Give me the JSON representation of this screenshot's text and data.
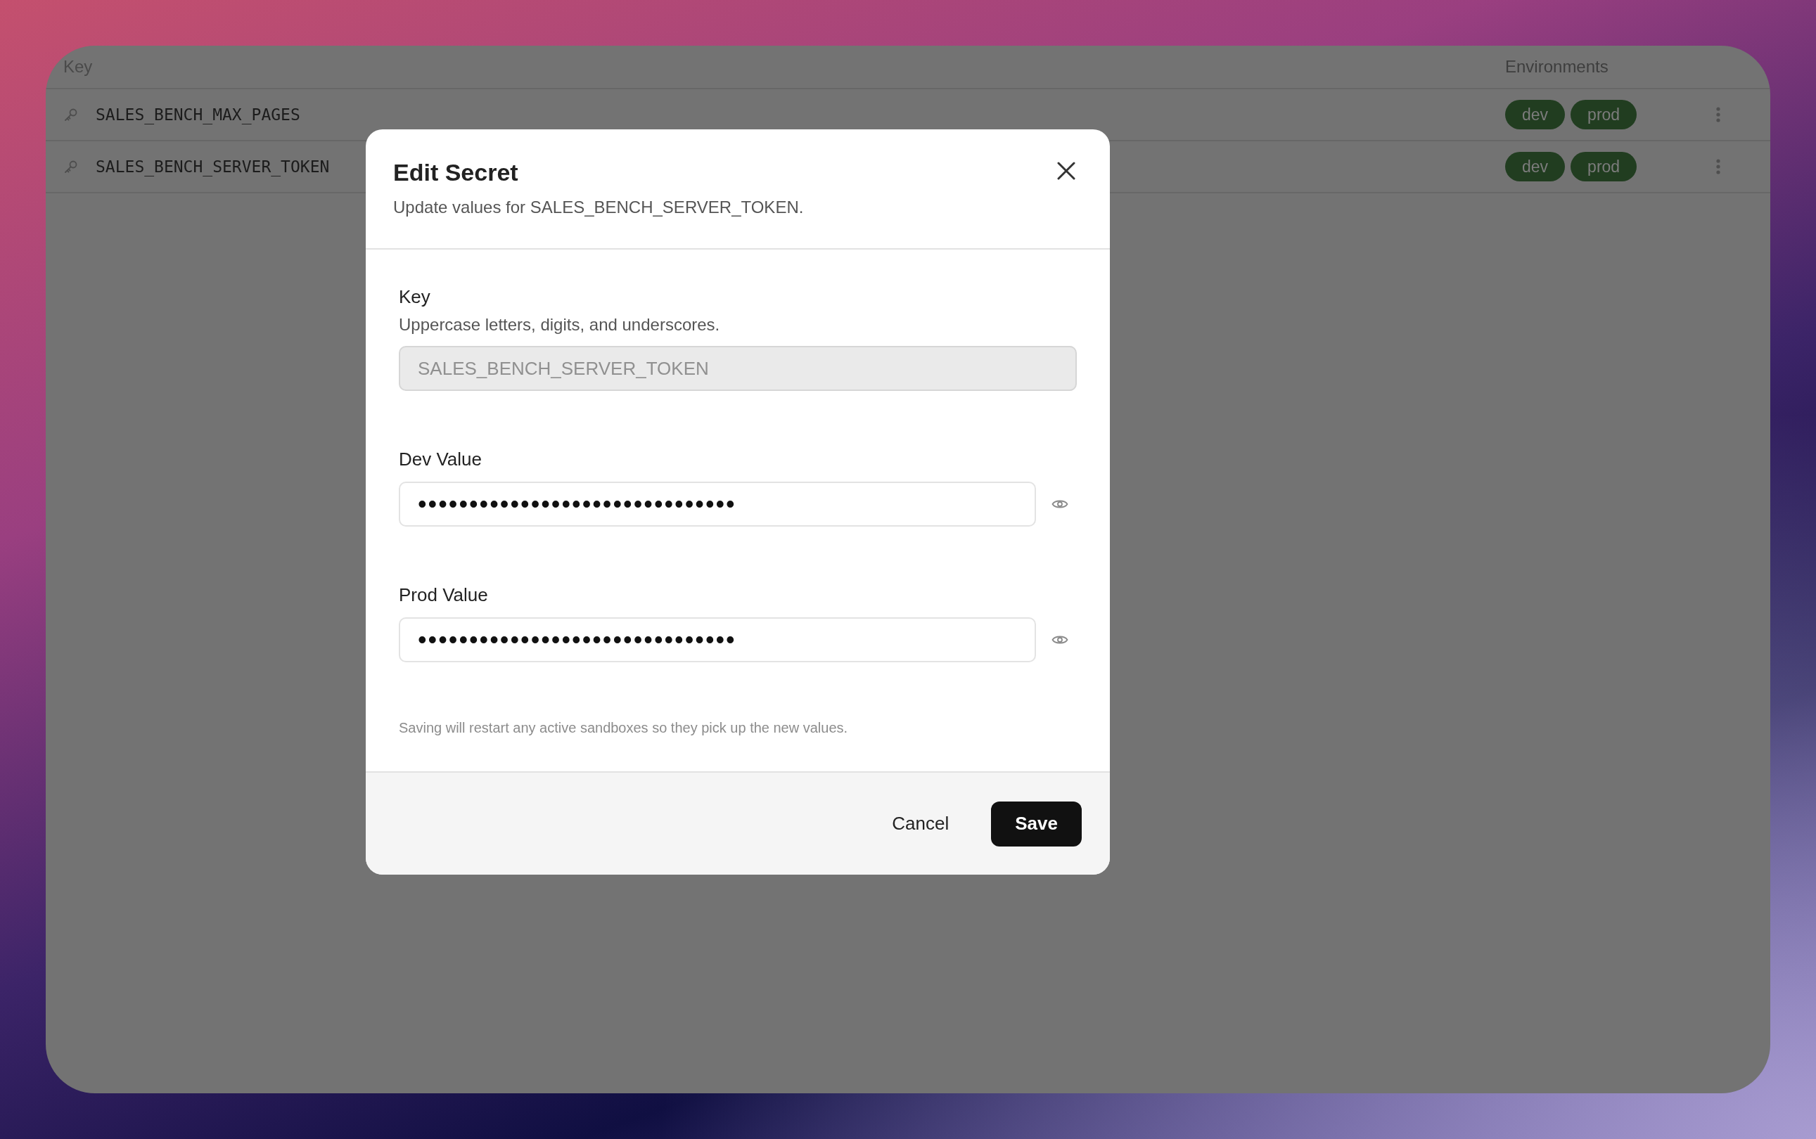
{
  "table": {
    "columns": [
      "Key",
      "Environments"
    ],
    "rows": [
      {
        "key": "SALES_BENCH_MAX_PAGES",
        "environments": [
          "dev",
          "prod"
        ]
      },
      {
        "key": "SALES_BENCH_SERVER_TOKEN",
        "environments": [
          "dev",
          "prod"
        ]
      }
    ]
  },
  "dialog": {
    "title": "Edit Secret",
    "subtitle": "Update values for SALES_BENCH_SERVER_TOKEN.",
    "fields": [
      {
        "kind": "text",
        "label": "Key",
        "hint": "Uppercase letters, digits, and underscores.",
        "value": "SALES_BENCH_SERVER_TOKEN",
        "disabled": true
      },
      {
        "kind": "secret",
        "label": "Dev Value",
        "value": "•••••••••••••••••••••••••••••••",
        "disabled": false
      },
      {
        "kind": "secret",
        "label": "Prod Value",
        "value": "•••••••••••••••••••••••••••••••",
        "disabled": false
      }
    ],
    "note": "Saving will restart any active sandboxes so they pick up the new values.",
    "buttons": [
      {
        "label": "Cancel",
        "kind": "secondary"
      },
      {
        "label": "Save",
        "kind": "primary"
      }
    ]
  }
}
